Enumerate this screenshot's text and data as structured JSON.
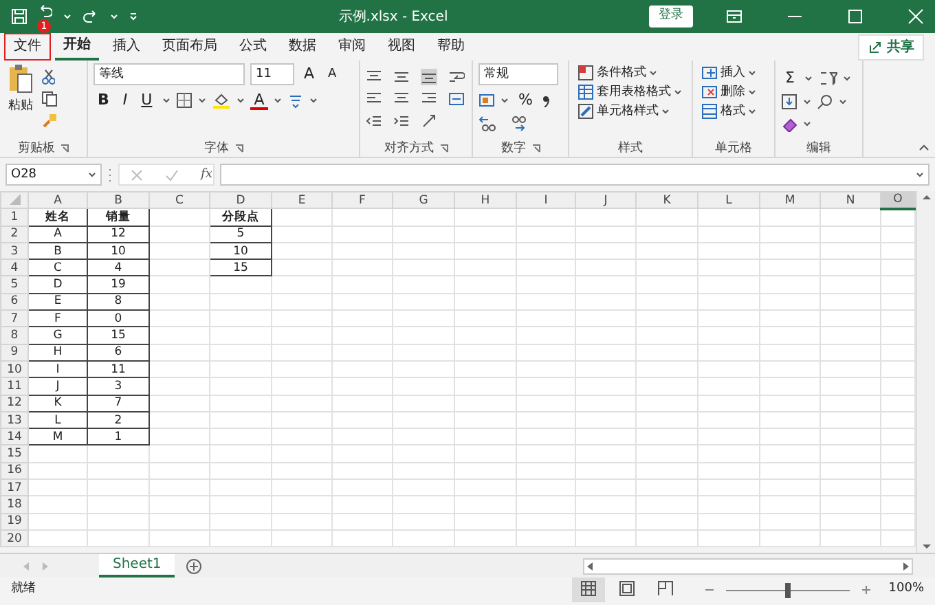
{
  "title_bar": {
    "title": "示例.xlsx  -  Excel",
    "sign_in": "登录",
    "qat_badge": "1"
  },
  "tabs": [
    {
      "label": "文件",
      "selected": false,
      "highlighted": true
    },
    {
      "label": "开始",
      "selected": true,
      "highlighted": false
    },
    {
      "label": "插入",
      "selected": false,
      "highlighted": false
    },
    {
      "label": "页面布局",
      "selected": false,
      "highlighted": false
    },
    {
      "label": "公式",
      "selected": false,
      "highlighted": false
    },
    {
      "label": "数据",
      "selected": false,
      "highlighted": false
    },
    {
      "label": "审阅",
      "selected": false,
      "highlighted": false
    },
    {
      "label": "视图",
      "selected": false,
      "highlighted": false
    },
    {
      "label": "帮助",
      "selected": false,
      "highlighted": false
    }
  ],
  "share": "共享",
  "ribbon": {
    "clipboard": {
      "label": "剪贴板",
      "paste": "粘贴"
    },
    "font": {
      "label": "字体",
      "font_name": "等线",
      "font_size": "11",
      "grow": "A",
      "shrink": "A",
      "bold": "B",
      "italic": "I",
      "underline": "U",
      "font_color": "A"
    },
    "alignment": {
      "label": "对齐方式"
    },
    "number": {
      "label": "数字",
      "format": "常规",
      "percent": "%"
    },
    "styles": {
      "label": "样式",
      "items": [
        "条件格式",
        "套用表格格式",
        "单元格样式"
      ]
    },
    "cells": {
      "label": "单元格",
      "items": [
        "插入",
        "删除",
        "格式"
      ]
    },
    "editing": {
      "label": "编辑",
      "sum": "Σ"
    }
  },
  "formula_bar": {
    "name_box": "O28",
    "fx": "fx"
  },
  "columns": [
    {
      "label": "A",
      "selected": false
    },
    {
      "label": "B",
      "selected": false
    },
    {
      "label": "C",
      "selected": false
    },
    {
      "label": "D",
      "selected": false
    },
    {
      "label": "E",
      "selected": false
    },
    {
      "label": "F",
      "selected": false
    },
    {
      "label": "G",
      "selected": false
    },
    {
      "label": "H",
      "selected": false
    },
    {
      "label": "I",
      "selected": false
    },
    {
      "label": "J",
      "selected": false
    },
    {
      "label": "K",
      "selected": false
    },
    {
      "label": "L",
      "selected": false
    },
    {
      "label": "M",
      "selected": false
    },
    {
      "label": "N",
      "selected": false
    },
    {
      "label": "O",
      "selected": true
    }
  ],
  "rows": [
    {
      "header": "1",
      "cells": [
        "姓名",
        "销量",
        "",
        "分段点"
      ]
    },
    {
      "header": "2",
      "cells": [
        "A",
        "12",
        "",
        "5"
      ]
    },
    {
      "header": "3",
      "cells": [
        "B",
        "10",
        "",
        "10"
      ]
    },
    {
      "header": "4",
      "cells": [
        "C",
        "4",
        "",
        "15"
      ]
    },
    {
      "header": "5",
      "cells": [
        "D",
        "19"
      ]
    },
    {
      "header": "6",
      "cells": [
        "E",
        "8"
      ]
    },
    {
      "header": "7",
      "cells": [
        "F",
        "0"
      ]
    },
    {
      "header": "8",
      "cells": [
        "G",
        "15"
      ]
    },
    {
      "header": "9",
      "cells": [
        "H",
        "6"
      ]
    },
    {
      "header": "10",
      "cells": [
        "I",
        "11"
      ]
    },
    {
      "header": "11",
      "cells": [
        "J",
        "3"
      ]
    },
    {
      "header": "12",
      "cells": [
        "K",
        "7"
      ]
    },
    {
      "header": "13",
      "cells": [
        "L",
        "2"
      ]
    },
    {
      "header": "14",
      "cells": [
        "M",
        "1"
      ]
    },
    {
      "header": "15",
      "cells": []
    },
    {
      "header": "16",
      "cells": []
    },
    {
      "header": "17",
      "cells": []
    },
    {
      "header": "18",
      "cells": []
    },
    {
      "header": "19",
      "cells": []
    },
    {
      "header": "20",
      "cells": []
    }
  ],
  "sheet_tabs": [
    {
      "label": "Sheet1",
      "selected": true
    }
  ],
  "status_bar": {
    "text": "就绪",
    "views": [
      {
        "kind": "normal",
        "selected": true
      },
      {
        "kind": "page-layout",
        "selected": false
      },
      {
        "kind": "page-break",
        "selected": false
      }
    ],
    "zoom": {
      "level": 0.5,
      "reading": "100%"
    }
  }
}
